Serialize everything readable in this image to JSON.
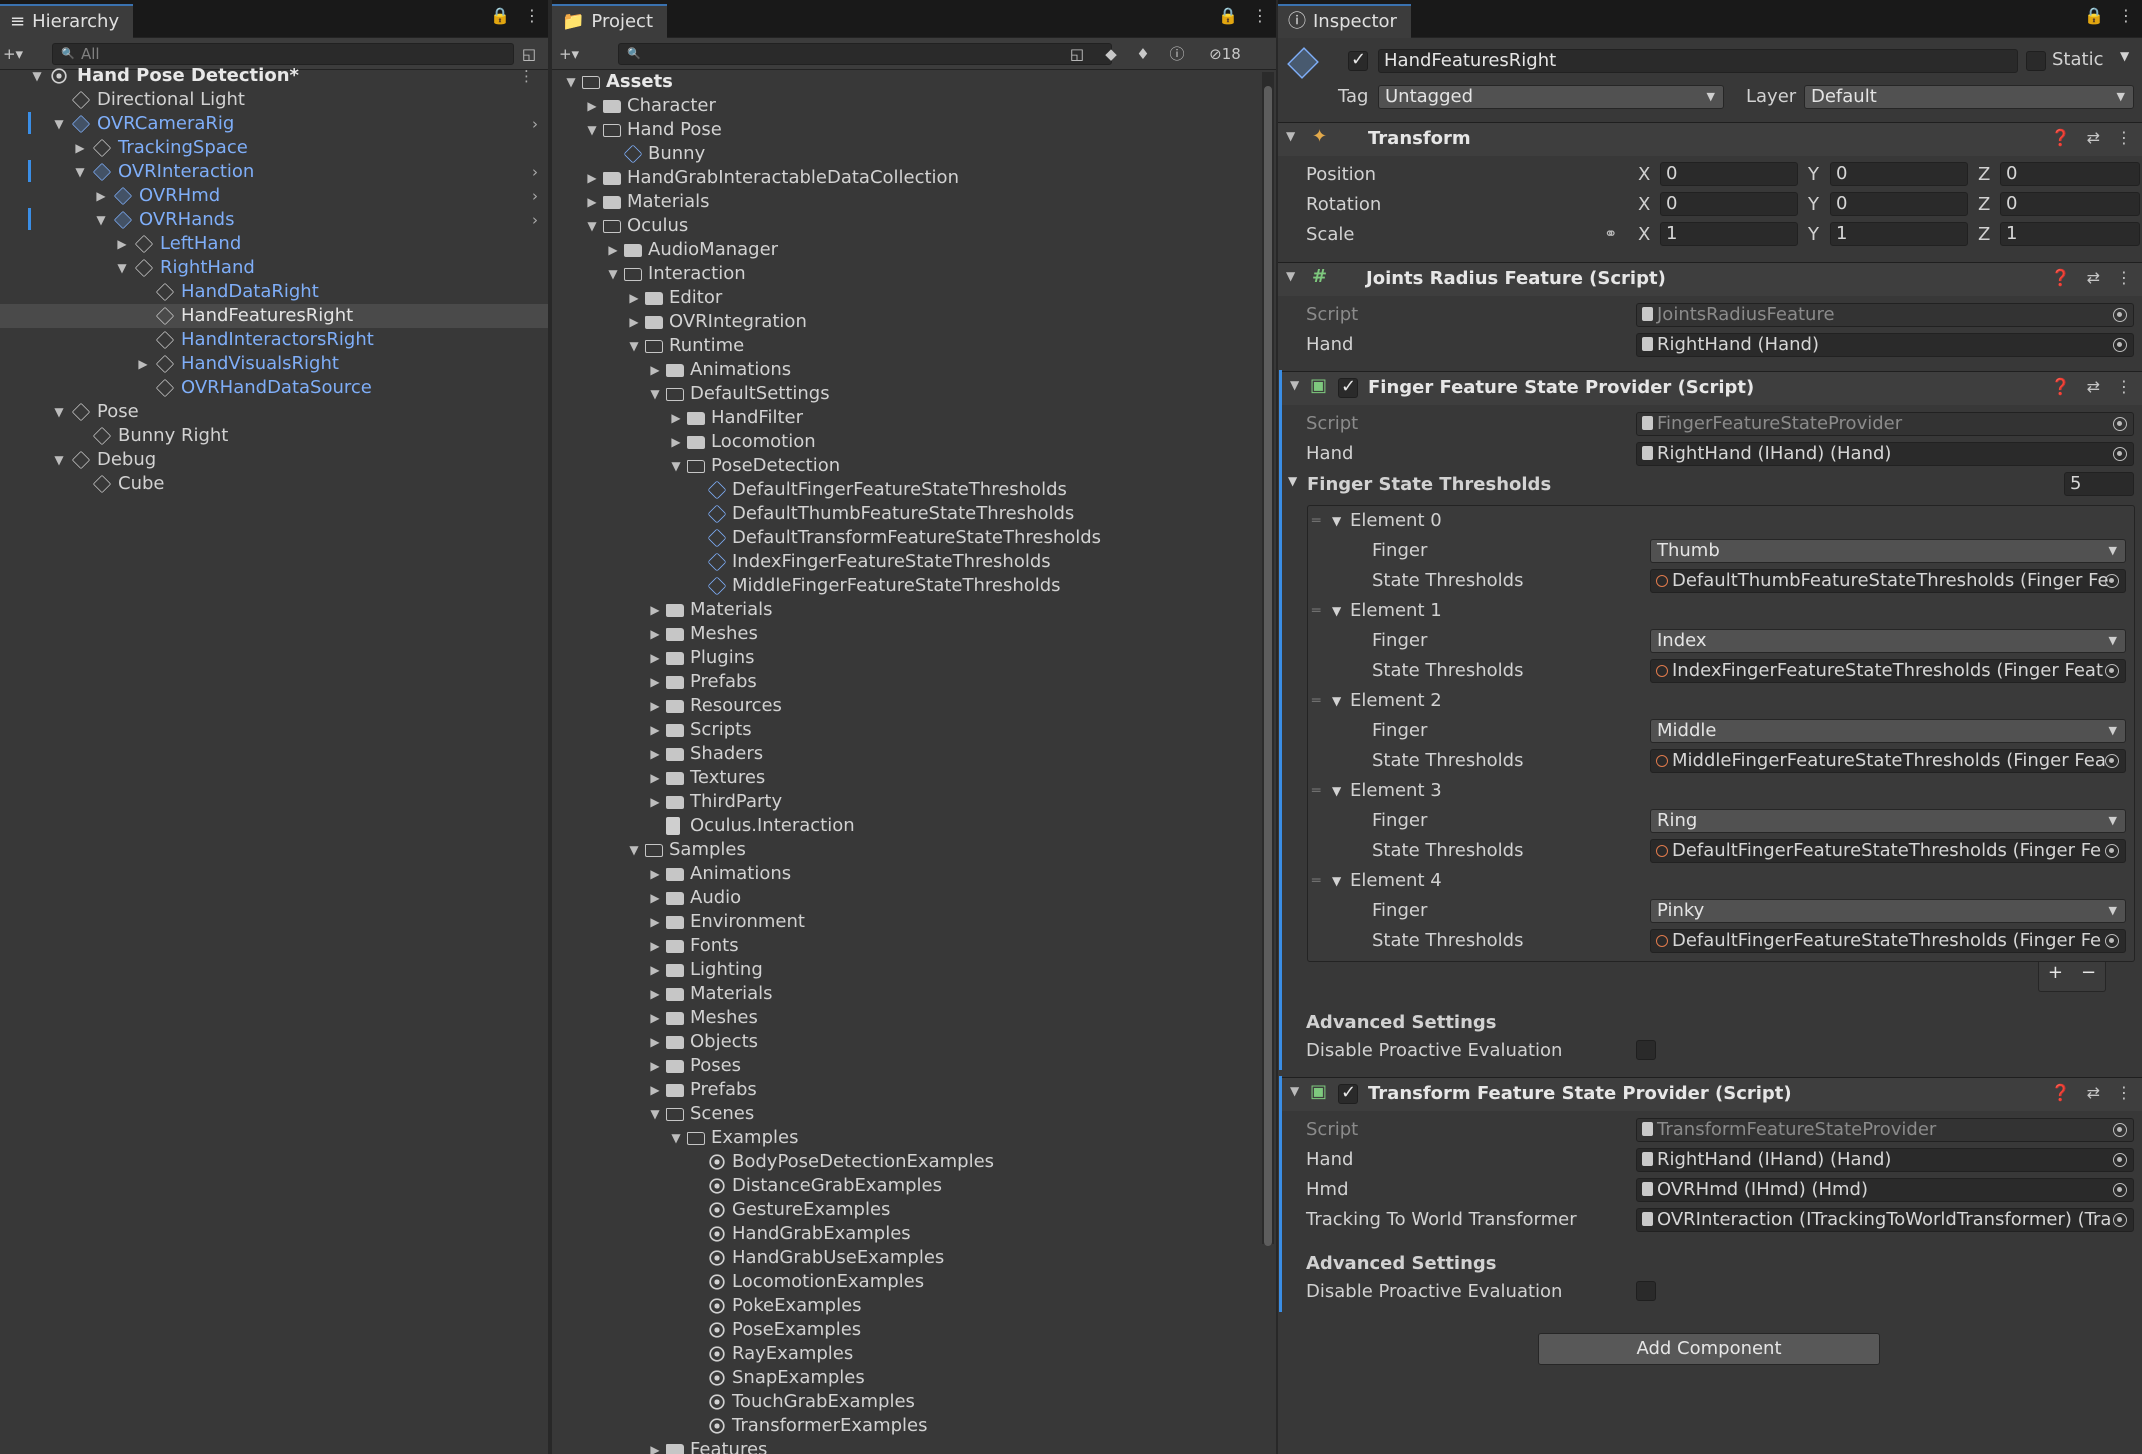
{
  "hierarchy": {
    "tab_label": "Hierarchy",
    "search_placeholder": "All",
    "scene_name": "Hand Pose Detection*",
    "items": [
      {
        "label": "Directional Light"
      },
      {
        "label": "OVRCameraRig"
      },
      {
        "label": "TrackingSpace"
      },
      {
        "label": "OVRInteraction"
      },
      {
        "label": "OVRHmd"
      },
      {
        "label": "OVRHands"
      },
      {
        "label": "LeftHand"
      },
      {
        "label": "RightHand"
      },
      {
        "label": "HandDataRight"
      },
      {
        "label": "HandFeaturesRight"
      },
      {
        "label": "HandInteractorsRight"
      },
      {
        "label": "HandVisualsRight"
      },
      {
        "label": "OVRHandDataSource"
      },
      {
        "label": "Pose"
      },
      {
        "label": "Bunny Right"
      },
      {
        "label": "Debug"
      },
      {
        "label": "Cube"
      }
    ]
  },
  "project": {
    "tab_label": "Project",
    "hidden_count": "18",
    "items": [
      {
        "label": "Assets"
      },
      {
        "label": "Character"
      },
      {
        "label": "Hand Pose"
      },
      {
        "label": "Bunny"
      },
      {
        "label": "HandGrabInteractableDataCollection"
      },
      {
        "label": "Materials"
      },
      {
        "label": "Oculus"
      },
      {
        "label": "AudioManager"
      },
      {
        "label": "Interaction"
      },
      {
        "label": "Editor"
      },
      {
        "label": "OVRIntegration"
      },
      {
        "label": "Runtime"
      },
      {
        "label": "Animations"
      },
      {
        "label": "DefaultSettings"
      },
      {
        "label": "HandFilter"
      },
      {
        "label": "Locomotion"
      },
      {
        "label": "PoseDetection"
      },
      {
        "label": "DefaultFingerFeatureStateThresholds"
      },
      {
        "label": "DefaultThumbFeatureStateThresholds"
      },
      {
        "label": "DefaultTransformFeatureStateThresholds"
      },
      {
        "label": "IndexFingerFeatureStateThresholds"
      },
      {
        "label": "MiddleFingerFeatureStateThresholds"
      },
      {
        "label": "Materials"
      },
      {
        "label": "Meshes"
      },
      {
        "label": "Plugins"
      },
      {
        "label": "Prefabs"
      },
      {
        "label": "Resources"
      },
      {
        "label": "Scripts"
      },
      {
        "label": "Shaders"
      },
      {
        "label": "Textures"
      },
      {
        "label": "ThirdParty"
      },
      {
        "label": "Oculus.Interaction"
      },
      {
        "label": "Samples"
      },
      {
        "label": "Animations"
      },
      {
        "label": "Audio"
      },
      {
        "label": "Environment"
      },
      {
        "label": "Fonts"
      },
      {
        "label": "Lighting"
      },
      {
        "label": "Materials"
      },
      {
        "label": "Meshes"
      },
      {
        "label": "Objects"
      },
      {
        "label": "Poses"
      },
      {
        "label": "Prefabs"
      },
      {
        "label": "Scenes"
      },
      {
        "label": "Examples"
      },
      {
        "label": "BodyPoseDetectionExamples"
      },
      {
        "label": "DistanceGrabExamples"
      },
      {
        "label": "GestureExamples"
      },
      {
        "label": "HandGrabExamples"
      },
      {
        "label": "HandGrabUseExamples"
      },
      {
        "label": "LocomotionExamples"
      },
      {
        "label": "PokeExamples"
      },
      {
        "label": "PoseExamples"
      },
      {
        "label": "RayExamples"
      },
      {
        "label": "SnapExamples"
      },
      {
        "label": "TouchGrabExamples"
      },
      {
        "label": "TransformerExamples"
      },
      {
        "label": "Features"
      }
    ]
  },
  "inspector": {
    "tab_label": "Inspector",
    "object_name": "HandFeaturesRight",
    "static_label": "Static",
    "tag_label": "Tag",
    "tag_value": "Untagged",
    "layer_label": "Layer",
    "layer_value": "Default",
    "transform": {
      "title": "Transform",
      "position_label": "Position",
      "rotation_label": "Rotation",
      "scale_label": "Scale",
      "x": "X",
      "y": "Y",
      "z": "Z",
      "position": [
        "0",
        "0",
        "0"
      ],
      "rotation": [
        "0",
        "0",
        "0"
      ],
      "scale": [
        "1",
        "1",
        "1"
      ]
    },
    "joints": {
      "title": "Joints Radius Feature (Script)",
      "script_label": "Script",
      "script_value": "JointsRadiusFeature",
      "hand_label": "Hand",
      "hand_value": "RightHand (Hand)"
    },
    "finger_provider": {
      "title": "Finger Feature State Provider (Script)",
      "script_label": "Script",
      "script_value": "FingerFeatureStateProvider",
      "hand_label": "Hand",
      "hand_value": "RightHand (IHand) (Hand)",
      "thresholds_label": "Finger State Thresholds",
      "thresholds_count": "5",
      "finger_label": "Finger",
      "state_label": "State Thresholds",
      "elements": [
        {
          "name": "Element 0",
          "finger": "Thumb",
          "thresholds": "DefaultThumbFeatureStateThresholds (Finger Fe"
        },
        {
          "name": "Element 1",
          "finger": "Index",
          "thresholds": "IndexFingerFeatureStateThresholds (Finger Feat"
        },
        {
          "name": "Element 2",
          "finger": "Middle",
          "thresholds": "MiddleFingerFeatureStateThresholds (Finger Fea"
        },
        {
          "name": "Element 3",
          "finger": "Ring",
          "thresholds": "DefaultFingerFeatureStateThresholds (Finger Fe"
        },
        {
          "name": "Element 4",
          "finger": "Pinky",
          "thresholds": "DefaultFingerFeatureStateThresholds (Finger Fe"
        }
      ],
      "add_symbol": "+",
      "remove_symbol": "−",
      "advanced_label": "Advanced Settings",
      "disable_label": "Disable Proactive Evaluation"
    },
    "transform_provider": {
      "title": "Transform Feature State Provider (Script)",
      "script_label": "Script",
      "script_value": "TransformFeatureStateProvider",
      "hand_label": "Hand",
      "hand_value": "RightHand (IHand) (Hand)",
      "hmd_label": "Hmd",
      "hmd_value": "OVRHmd (IHmd) (Hmd)",
      "tracking_label": "Tracking To World Transformer",
      "tracking_value": "OVRInteraction (ITrackingToWorldTransformer) (Tra",
      "advanced_label": "Advanced Settings",
      "disable_label": "Disable Proactive Evaluation"
    },
    "add_component_label": "Add Component"
  }
}
